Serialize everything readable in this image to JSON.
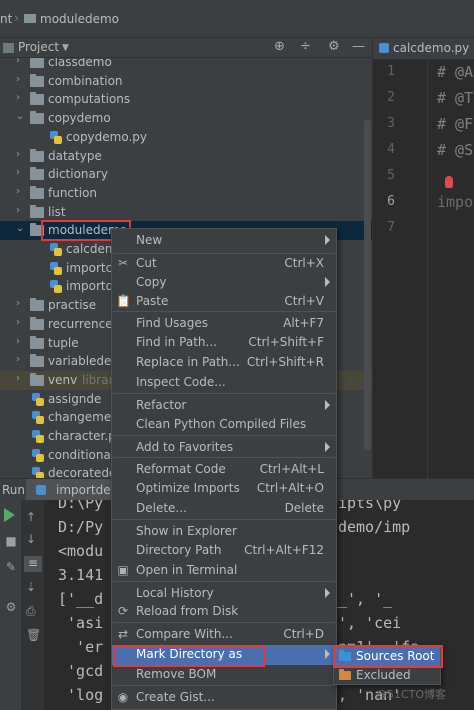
{
  "breadcrumb": {
    "left": "nt",
    "project": "moduledemo"
  },
  "project_panel": {
    "title": "Project"
  },
  "editor": {
    "tab": "calcdemo.py",
    "line_numbers": [
      "1",
      "2",
      "3",
      "4",
      "5",
      "6",
      "7"
    ],
    "lines": [
      "# @A",
      "# @T",
      "# @F",
      "# @S",
      "",
      "impo",
      ""
    ]
  },
  "tree": {
    "items": [
      {
        "label": "classdemo",
        "kind": "folder",
        "depth": 1,
        "expanded": false
      },
      {
        "label": "combination",
        "kind": "folder",
        "depth": 1,
        "expanded": false
      },
      {
        "label": "computations",
        "kind": "folder",
        "depth": 1,
        "expanded": false
      },
      {
        "label": "copydemo",
        "kind": "folder",
        "depth": 1,
        "expanded": true
      },
      {
        "label": "copydemo.py",
        "kind": "py",
        "depth": 2
      },
      {
        "label": "datatype",
        "kind": "folder",
        "depth": 1,
        "expanded": false
      },
      {
        "label": "dictionary",
        "kind": "folder",
        "depth": 1,
        "expanded": false
      },
      {
        "label": "function",
        "kind": "folder",
        "depth": 1,
        "expanded": false
      },
      {
        "label": "list",
        "kind": "folder",
        "depth": 1,
        "expanded": false
      },
      {
        "label": "moduledemo",
        "kind": "folder",
        "depth": 1,
        "expanded": true
      },
      {
        "label": "calcdemo",
        "kind": "py",
        "depth": 2
      },
      {
        "label": "importcu",
        "kind": "py",
        "depth": 2
      },
      {
        "label": "importde",
        "kind": "py",
        "depth": 2
      },
      {
        "label": "practise",
        "kind": "folder",
        "depth": 1,
        "expanded": false
      },
      {
        "label": "recurrenced",
        "kind": "folder",
        "depth": 1,
        "expanded": false
      },
      {
        "label": "tuple",
        "kind": "folder",
        "depth": 1,
        "expanded": false
      },
      {
        "label": "variablede",
        "kind": "folder",
        "depth": 1,
        "expanded": false
      },
      {
        "label": "venv",
        "kind": "folder",
        "depth": 1,
        "expanded": false,
        "extra": "library"
      },
      {
        "label": "assignde",
        "kind": "py",
        "depth": 1
      },
      {
        "label": "changemea",
        "kind": "py",
        "depth": 1
      },
      {
        "label": "character.py",
        "kind": "py",
        "depth": 1
      },
      {
        "label": "conditionale",
        "kind": "py",
        "depth": 1
      },
      {
        "label": "decoratede",
        "kind": "py",
        "depth": 1
      }
    ]
  },
  "run": {
    "label": "Run:",
    "tab": "importde"
  },
  "console": {
    "lines": [
      "D:\\Py                    nv\\Scripts\\py",
      "D:/Py                    moduledemo/imp",
      "<modu",
      "3.141",
      "['__d                   __name__', '_",
      " 'asi                    'atanh', 'cei",
      "  'er                    ', 'expm1', 'fa",
      " 'gcd                    'isfinite', '",
      " 'log                    'modf', 'nan'"
    ]
  },
  "context_menu": {
    "items": [
      {
        "type": "item",
        "label": "New",
        "shortcut": "",
        "icon": "",
        "submenu": true
      },
      {
        "type": "sep"
      },
      {
        "type": "item",
        "label": "Cut",
        "shortcut": "Ctrl+X",
        "icon": "✂",
        "submenu": false
      },
      {
        "type": "item",
        "label": "Copy",
        "shortcut": "",
        "icon": "",
        "submenu": true
      },
      {
        "type": "item",
        "label": "Paste",
        "shortcut": "Ctrl+V",
        "icon": "📋",
        "submenu": false
      },
      {
        "type": "sep"
      },
      {
        "type": "item",
        "label": "Find Usages",
        "shortcut": "Alt+F7",
        "icon": "",
        "submenu": false
      },
      {
        "type": "item",
        "label": "Find in Path...",
        "shortcut": "Ctrl+Shift+F",
        "icon": "",
        "submenu": false
      },
      {
        "type": "item",
        "label": "Replace in Path...",
        "shortcut": "Ctrl+Shift+R",
        "icon": "",
        "submenu": false
      },
      {
        "type": "item",
        "label": "Inspect Code...",
        "shortcut": "",
        "icon": "",
        "submenu": false
      },
      {
        "type": "sep"
      },
      {
        "type": "item",
        "label": "Refactor",
        "shortcut": "",
        "icon": "",
        "submenu": true
      },
      {
        "type": "item",
        "label": "Clean Python Compiled Files",
        "shortcut": "",
        "icon": "",
        "submenu": false
      },
      {
        "type": "sep"
      },
      {
        "type": "item",
        "label": "Add to Favorites",
        "shortcut": "",
        "icon": "",
        "submenu": true
      },
      {
        "type": "sep"
      },
      {
        "type": "item",
        "label": "Reformat Code",
        "shortcut": "Ctrl+Alt+L",
        "icon": "",
        "submenu": false
      },
      {
        "type": "item",
        "label": "Optimize Imports",
        "shortcut": "Ctrl+Alt+O",
        "icon": "",
        "submenu": false
      },
      {
        "type": "item",
        "label": "Delete...",
        "shortcut": "Delete",
        "icon": "",
        "submenu": false
      },
      {
        "type": "sep"
      },
      {
        "type": "item",
        "label": "Show in Explorer",
        "shortcut": "",
        "icon": "",
        "submenu": false
      },
      {
        "type": "item",
        "label": "Directory Path",
        "shortcut": "Ctrl+Alt+F12",
        "icon": "",
        "submenu": false
      },
      {
        "type": "item",
        "label": "Open in Terminal",
        "shortcut": "",
        "icon": "▣",
        "submenu": false
      },
      {
        "type": "sep"
      },
      {
        "type": "item",
        "label": "Local History",
        "shortcut": "",
        "icon": "",
        "submenu": true
      },
      {
        "type": "item",
        "label": "Reload from Disk",
        "shortcut": "",
        "icon": "⟳",
        "submenu": false
      },
      {
        "type": "sep"
      },
      {
        "type": "item",
        "label": "Compare With...",
        "shortcut": "Ctrl+D",
        "icon": "⇄",
        "submenu": false
      },
      {
        "type": "item",
        "label": "Mark Directory as",
        "shortcut": "",
        "icon": "",
        "submenu": true,
        "active": true
      },
      {
        "type": "item",
        "label": "Remove BOM",
        "shortcut": "",
        "icon": "",
        "submenu": false
      },
      {
        "type": "sep"
      },
      {
        "type": "item",
        "label": "Create Gist...",
        "shortcut": "",
        "icon": "◉",
        "submenu": false
      }
    ]
  },
  "submenu": {
    "items": [
      {
        "label": "Sources Root",
        "color": "#3d8fd6",
        "active": true
      },
      {
        "label": "Excluded",
        "color": "#d08a3a",
        "active": false
      }
    ]
  },
  "watermark": "@51CTO博客"
}
